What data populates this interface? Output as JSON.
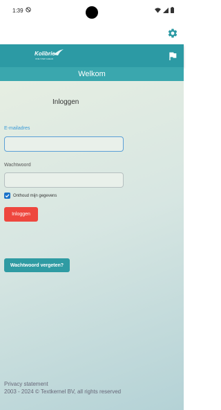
{
  "status_bar": {
    "time": "1:39"
  },
  "header": {
    "logo_text": "Kolibrie",
    "logo_tagline": "ONE STEP AHEAD"
  },
  "page": {
    "title": "Welkom"
  },
  "login": {
    "heading": "Inloggen",
    "email_label": "E-mailadres",
    "email_value": "",
    "password_label": "Wachtwoord",
    "password_value": "",
    "remember_label": "Onthoud mijn gegevens",
    "remember_checked": true,
    "submit_label": "Inloggen"
  },
  "forgot_password_label": "Wachtwoord vergeten?",
  "footer": {
    "privacy_label": "Privacy statement",
    "copyright": "2003 - 2024 © Textkernel BV, all rights reserved"
  },
  "colors": {
    "header": "#2c9aa4",
    "title_bar": "#3aa7ae",
    "login_button": "#ee473e",
    "forgot_button": "#2f9ba3",
    "checkbox": "#1a73c9"
  },
  "icons": [
    "do-not-disturb-icon",
    "wifi-icon",
    "signal-icon",
    "battery-icon",
    "gear-icon",
    "flag-icon",
    "checkmark-icon"
  ]
}
